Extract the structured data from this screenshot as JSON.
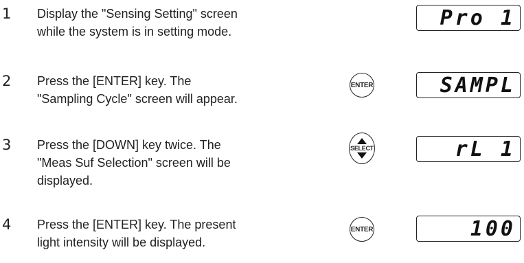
{
  "steps": [
    {
      "number": "1",
      "line1": "Display the \"Sensing Setting\" screen",
      "line2": "while the system is in setting mode.",
      "line3": "",
      "key": "",
      "display": "Pro 1"
    },
    {
      "number": "2",
      "line1": "Press the [ENTER] key. The",
      "line2": "\"Sampling Cycle\" screen will appear.",
      "line3": "",
      "key": "ENTER",
      "display": "SAMPL"
    },
    {
      "number": "3",
      "line1": "Press the [DOWN] key twice. The",
      "line2": "\"Meas Suf Selection\" screen will be",
      "line3": "displayed.",
      "key": "SELECT",
      "display": "rL 1"
    },
    {
      "number": "4",
      "line1": "Press the [ENTER] key. The present",
      "line2": "light intensity will be displayed.",
      "line3": "",
      "key": "ENTER",
      "display": "100"
    }
  ]
}
